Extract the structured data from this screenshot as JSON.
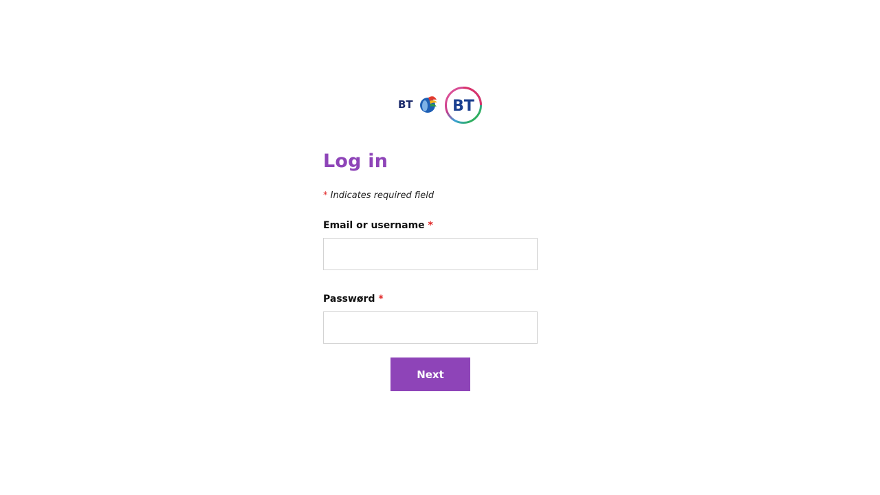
{
  "brand": {
    "logos": [
      "bt-legacy-piper-logo",
      "bt-roundel-logo"
    ],
    "logo_old_text": "BT",
    "logo_new_text": "BT",
    "accent_color": "#8e44b8",
    "required_color": "#e02424"
  },
  "form": {
    "title": "Log in",
    "required_marker": "*",
    "required_note": "Indicates required field",
    "email": {
      "label": "Email or username",
      "required_marker": "*",
      "value": "",
      "placeholder": ""
    },
    "password": {
      "label": "Passwørd",
      "required_marker": "*",
      "value": "",
      "placeholder": ""
    },
    "submit_label": "Next"
  }
}
